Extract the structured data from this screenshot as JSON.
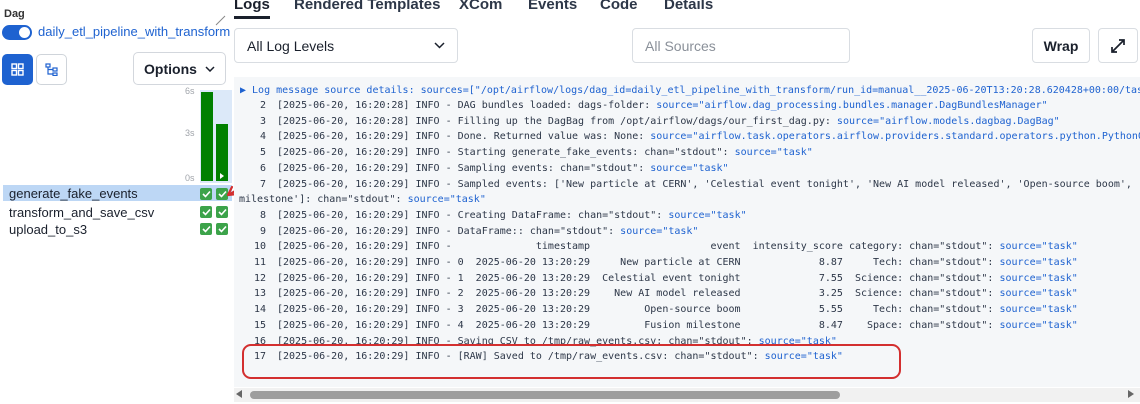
{
  "sidebar": {
    "dag_label": "Dag",
    "dag_name": "daily_etl_pipeline_with_transform",
    "options_label": "Options",
    "duration_ticks": [
      "6s",
      "3s",
      "0s"
    ],
    "tasks": [
      {
        "name": "generate_fake_events",
        "selected": true
      },
      {
        "name": "transform_and_save_csv",
        "selected": false
      },
      {
        "name": "upload_to_s3",
        "selected": false
      }
    ]
  },
  "tabs": [
    {
      "label": "Logs",
      "active": true
    },
    {
      "label": "Rendered Templates",
      "active": false
    },
    {
      "label": "XCom",
      "active": false
    },
    {
      "label": "Events",
      "active": false
    },
    {
      "label": "Code",
      "active": false
    },
    {
      "label": "Details",
      "active": false
    }
  ],
  "toolbar": {
    "log_level": "All Log Levels",
    "sources_placeholder": "All Sources",
    "wrap_label": "Wrap"
  },
  "log": {
    "header": "▶ Log message source details: sources=[\"/opt/airflow/logs/dag_id=daily_etl_pipeline_with_transform/run_id=manual__2025-06-20T13:20:28.620428+00:00/task_",
    "lines": [
      {
        "n": "2",
        "text": "[2025-06-20, 16:20:28] INFO - DAG bundles loaded: dags-folder: ",
        "source": "source=\"airflow.dag_processing.bundles.manager.DagBundlesManager\""
      },
      {
        "n": "3",
        "text": "[2025-06-20, 16:20:28] INFO - Filling up the DagBag from /opt/airflow/dags/our_first_dag.py: ",
        "source": "source=\"airflow.models.dagbag.DagBag\""
      },
      {
        "n": "4",
        "text": "[2025-06-20, 16:20:29] INFO - Done. Returned value was: None: ",
        "source": "source=\"airflow.task.operators.airflow.providers.standard.operators.python.PythonO"
      },
      {
        "n": "5",
        "text": "[2025-06-20, 16:20:29] INFO - Starting generate_fake_events: chan=\"stdout\": ",
        "source": "source=\"task\""
      },
      {
        "n": "6",
        "text": "[2025-06-20, 16:20:29] INFO - Sampling events: chan=\"stdout\": ",
        "source": "source=\"task\""
      },
      {
        "n": "7",
        "text": "[2025-06-20, 16:20:29] INFO - Sampled events: ['New particle at CERN', 'Celestial event tonight', 'New AI model released', 'Open-source boom', '",
        "source": ""
      },
      {
        "n": "",
        "text": "milestone']: chan=\"stdout\": ",
        "source": "source=\"task\"",
        "wrapped": true
      },
      {
        "n": "8",
        "text": "[2025-06-20, 16:20:29] INFO - Creating DataFrame: chan=\"stdout\": ",
        "source": "source=\"task\""
      },
      {
        "n": "9",
        "text": "[2025-06-20, 16:20:29] INFO - DataFrame:: chan=\"stdout\": ",
        "source": "source=\"task\""
      },
      {
        "n": "10",
        "text": "[2025-06-20, 16:20:29] INFO -              timestamp                    event  intensity_score category: chan=\"stdout\": ",
        "source": "source=\"task\""
      },
      {
        "n": "11",
        "text": "[2025-06-20, 16:20:29] INFO - 0  2025-06-20 13:20:29     New particle at CERN             8.87     Tech: chan=\"stdout\": ",
        "source": "source=\"task\""
      },
      {
        "n": "12",
        "text": "[2025-06-20, 16:20:29] INFO - 1  2025-06-20 13:20:29  Celestial event tonight             7.55  Science: chan=\"stdout\": ",
        "source": "source=\"task\""
      },
      {
        "n": "13",
        "text": "[2025-06-20, 16:20:29] INFO - 2  2025-06-20 13:20:29    New AI model released             3.25  Science: chan=\"stdout\": ",
        "source": "source=\"task\""
      },
      {
        "n": "14",
        "text": "[2025-06-20, 16:20:29] INFO - 3  2025-06-20 13:20:29         Open-source boom             5.55     Tech: chan=\"stdout\": ",
        "source": "source=\"task\""
      },
      {
        "n": "15",
        "text": "[2025-06-20, 16:20:29] INFO - 4  2025-06-20 13:20:29         Fusion milestone             8.47    Space: chan=\"stdout\": ",
        "source": "source=\"task\""
      },
      {
        "n": "16",
        "text": "[2025-06-20, 16:20:29] INFO - Saving CSV to /tmp/raw_events.csv: chan=\"stdout\": ",
        "source": "source=\"task\""
      },
      {
        "n": "17",
        "text": "[2025-06-20, 16:20:29] INFO - [RAW] Saved to /tmp/raw_events.csv: chan=\"stdout\": ",
        "source": "source=\"task\""
      }
    ]
  },
  "colors": {
    "accent": "#1e62d0",
    "success": "#008000",
    "highlight": "#d32f2f"
  }
}
